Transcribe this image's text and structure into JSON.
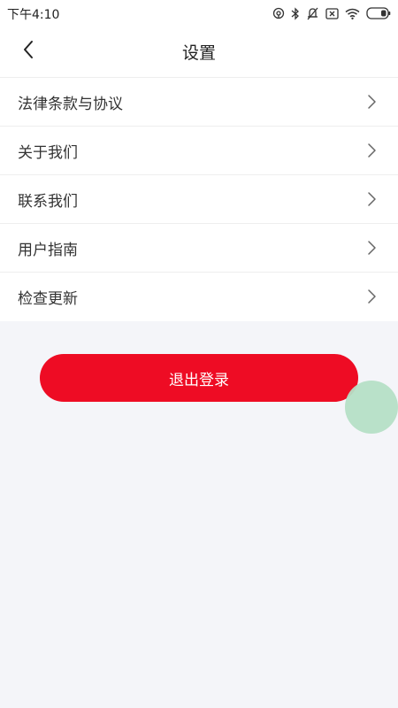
{
  "status_bar": {
    "time": "下午4:10",
    "icons": [
      "hotspot-icon",
      "bluetooth-icon",
      "mute-icon",
      "sim-none-icon",
      "wifi-icon",
      "battery-icon"
    ]
  },
  "header": {
    "title": "设置",
    "back_icon": "chevron-left-icon"
  },
  "menu": {
    "items": [
      {
        "label": "法律条款与协议"
      },
      {
        "label": "关于我们"
      },
      {
        "label": "联系我们"
      },
      {
        "label": "用户指南"
      },
      {
        "label": "检查更新"
      }
    ]
  },
  "logout": {
    "label": "退出登录"
  },
  "colors": {
    "accent": "#ee0c24",
    "background": "#f4f5f9",
    "bubble": "#b5dfc6"
  }
}
